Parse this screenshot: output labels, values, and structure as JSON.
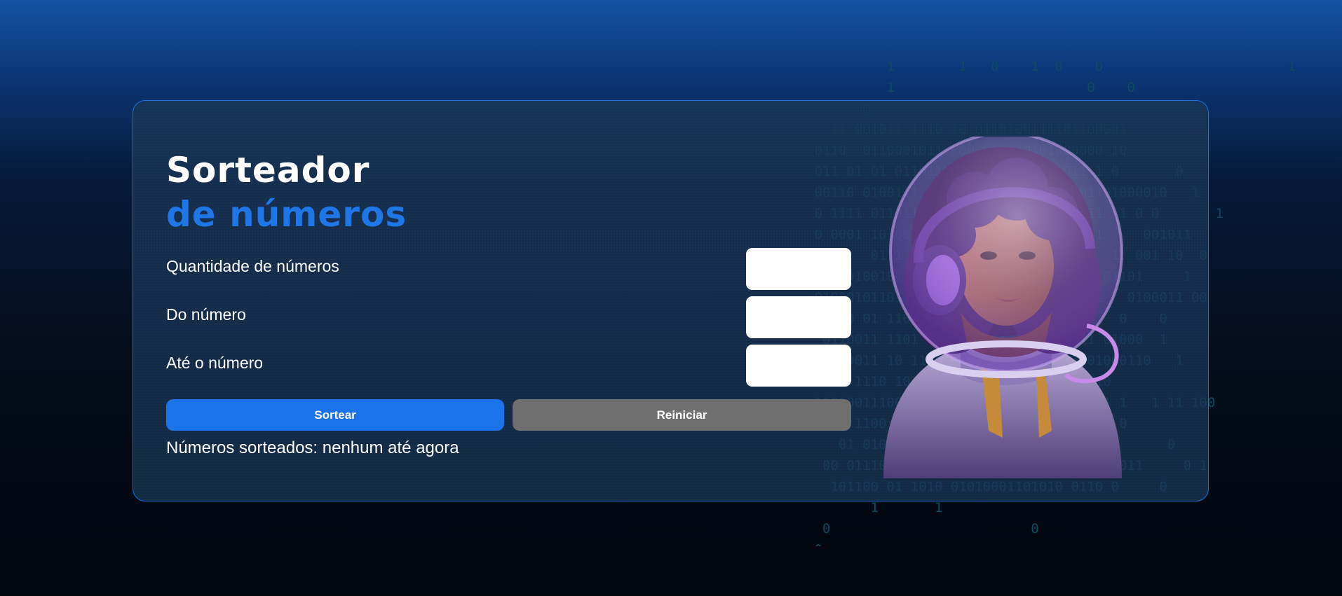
{
  "title": {
    "line1": "Sorteador",
    "line2": "de números"
  },
  "fields": [
    {
      "label": "Quantidade de números",
      "value": ""
    },
    {
      "label": "Do número",
      "value": ""
    },
    {
      "label": "Até o número",
      "value": ""
    }
  ],
  "buttons": {
    "draw": "Sortear",
    "reset": "Reiniciar"
  },
  "result": {
    "text": "Números sorteados: nenhum até agora"
  },
  "colors": {
    "accent": "#1a73e8",
    "title_accent": "#1f76e6",
    "reset_button": "#6f6f6f",
    "card_border": "#1f6fe0"
  },
  "illustration": {
    "icon": "astronaut-illustration"
  }
}
